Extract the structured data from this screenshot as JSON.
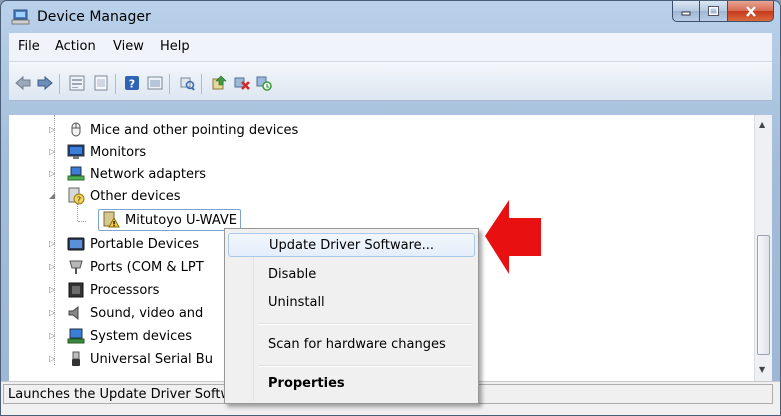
{
  "window": {
    "title": "Device Manager",
    "title_icon": "device-manager-icon"
  },
  "menu": [
    "File",
    "Action",
    "View",
    "Help"
  ],
  "toolbar": {
    "icons": [
      "back-arrow-icon",
      "forward-arrow-icon",
      "properties-grid-icon",
      "details-view-icon",
      "help-icon",
      "show-hide-icon",
      "scan-hardware-icon",
      "update-driver-icon",
      "uninstall-icon",
      "disable-icon"
    ]
  },
  "tree": {
    "items": [
      {
        "label": "Mice and other pointing devices",
        "icon": "mouse-icon",
        "expanded": false
      },
      {
        "label": "Monitors",
        "icon": "monitor-icon",
        "expanded": false
      },
      {
        "label": "Network adapters",
        "icon": "network-adapter-icon",
        "expanded": false
      },
      {
        "label": "Other devices",
        "icon": "unknown-device-icon",
        "expanded": true
      },
      {
        "label": "Mitutoyo U-WAVE",
        "icon": "warning-device-icon",
        "selected": true
      },
      {
        "label": "Portable Devices",
        "icon": "portable-device-icon",
        "expanded": false
      },
      {
        "label": "Ports (COM & LPT",
        "icon": "port-icon",
        "expanded": false
      },
      {
        "label": "Processors",
        "icon": "processor-icon",
        "expanded": false
      },
      {
        "label": "Sound, video and",
        "icon": "sound-icon",
        "expanded": false
      },
      {
        "label": "System devices",
        "icon": "system-device-icon",
        "expanded": false
      },
      {
        "label": "Universal Serial Bu",
        "icon": "usb-icon",
        "expanded": false
      }
    ]
  },
  "context_menu": {
    "items": [
      {
        "label": "Update Driver Software...",
        "hover": true
      },
      {
        "label": "Disable"
      },
      {
        "label": "Uninstall"
      },
      {
        "label": "Scan for hardware changes"
      },
      {
        "label": "Properties",
        "bold": true
      }
    ]
  },
  "status": {
    "text": "Launches the Update Driver Software Wizard for the selected device."
  },
  "colors": {
    "annotation_arrow": "#e81010",
    "selection_border": "#7da2ce",
    "menu_hover_border": "#a8c8ec"
  }
}
